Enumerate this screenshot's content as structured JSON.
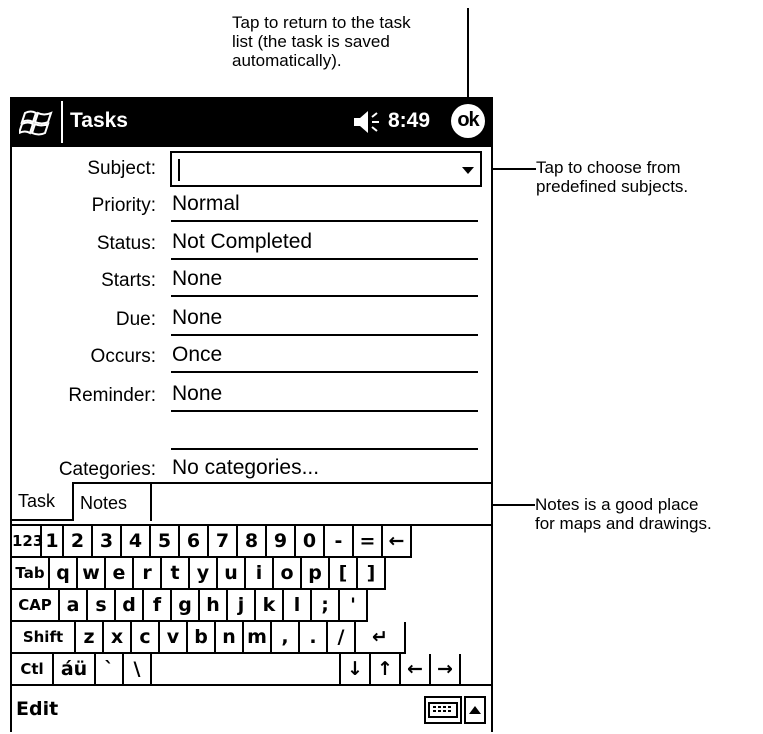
{
  "callouts": {
    "ok": "Tap to return to the task\nlist (the task is saved\nautomatically).",
    "subject_line1": "Tap to choose from",
    "subject_line2": "predefined subjects.",
    "notes_line1": "Notes is a good place",
    "notes_line2": "for maps and drawings."
  },
  "titlebar": {
    "title": "Tasks",
    "time": "8:49",
    "ok": "ok"
  },
  "form": {
    "subject": {
      "label": "Subject:",
      "value": ""
    },
    "priority": {
      "label": "Priority:",
      "value": "Normal"
    },
    "status": {
      "label": "Status:",
      "value": "Not Completed"
    },
    "starts": {
      "label": "Starts:",
      "value": "None"
    },
    "due": {
      "label": "Due:",
      "value": "None"
    },
    "occurs": {
      "label": "Occurs:",
      "value": "Once"
    },
    "reminder": {
      "label": "Reminder:",
      "value": "None"
    },
    "categories": {
      "label": "Categories:",
      "value": "No categories..."
    }
  },
  "tabs": {
    "task": "Task",
    "notes": "Notes"
  },
  "keyboard": {
    "row1": [
      "123",
      "1",
      "2",
      "3",
      "4",
      "5",
      "6",
      "7",
      "8",
      "9",
      "0",
      "-",
      "=",
      "←"
    ],
    "row2": [
      "Tab",
      "q",
      "w",
      "e",
      "r",
      "t",
      "y",
      "u",
      "i",
      "o",
      "p",
      "[",
      "]"
    ],
    "row3": [
      "CAP",
      "a",
      "s",
      "d",
      "f",
      "g",
      "h",
      "j",
      "k",
      "l",
      ";",
      "'"
    ],
    "row4": [
      "Shift",
      "z",
      "x",
      "c",
      "v",
      "b",
      "n",
      "m",
      ",",
      ".",
      "/",
      "↵"
    ],
    "row5": [
      "Ctl",
      "áü",
      "`",
      "\\",
      "",
      "↓",
      "↑",
      "←",
      "→"
    ]
  },
  "bottombar": {
    "edit": "Edit"
  }
}
